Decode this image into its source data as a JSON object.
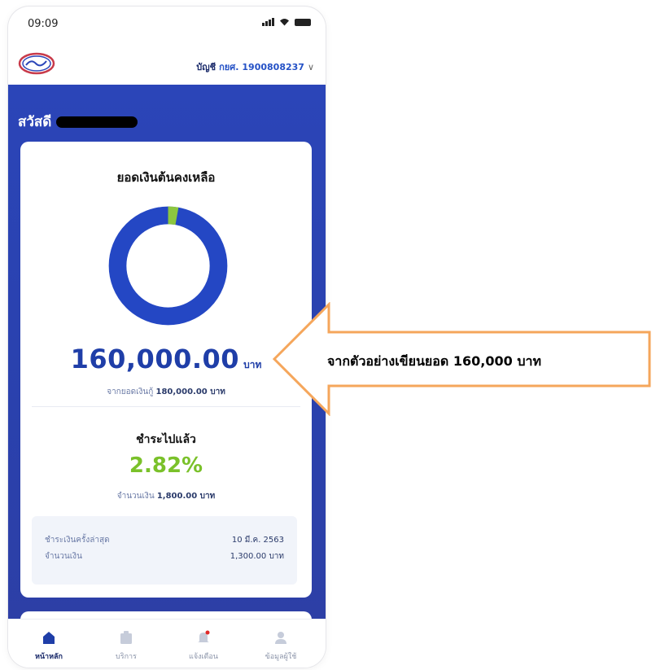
{
  "status_bar": {
    "time": "09:09"
  },
  "header": {
    "account_label": "บัญชี",
    "account_prefix": "กยศ.",
    "account_number": "1900808237",
    "chevron": "∨"
  },
  "greeting": {
    "prefix": "สวัสดี"
  },
  "balance_card": {
    "title": "ยอดเงินต้นคงเหลือ",
    "remaining_fraction": 0.9718,
    "paid_fraction": 0.0282,
    "amount": "160,000.00",
    "unit": "บาท",
    "from_label": "จากยอดเงินกู้",
    "from_value": "180,000.00 บาท",
    "paid_title": "ชำระไปแล้ว",
    "paid_percent": "2.82%",
    "paid_amount_label": "จำนวนเงิน",
    "paid_amount_value": "1,800.00 บาท",
    "last_payment_label": "ชำระเงินครั้งล่าสุด",
    "last_payment_date": "10 มี.ค. 2563",
    "last_amount_label": "จำนวนเงิน",
    "last_amount_value": "1,300.00 บาท"
  },
  "tabs": [
    {
      "label": "หน้าหลัก",
      "icon": "home-icon",
      "active": true
    },
    {
      "label": "บริการ",
      "icon": "services-icon",
      "active": false
    },
    {
      "label": "แจ้งเตือน",
      "icon": "bell-icon",
      "active": false
    },
    {
      "label": "ข้อมูลผู้ใช้",
      "icon": "user-icon",
      "active": false
    }
  ],
  "annotation": {
    "text": "จากตัวอย่างเขียนยอด 160,000 บาท",
    "arrow_color": "#f5a65b"
  },
  "colors": {
    "primary_blue": "#2b45b8",
    "donut_blue": "#2447c4",
    "donut_green": "#8cc63f",
    "paid_green": "#7ac12a"
  }
}
